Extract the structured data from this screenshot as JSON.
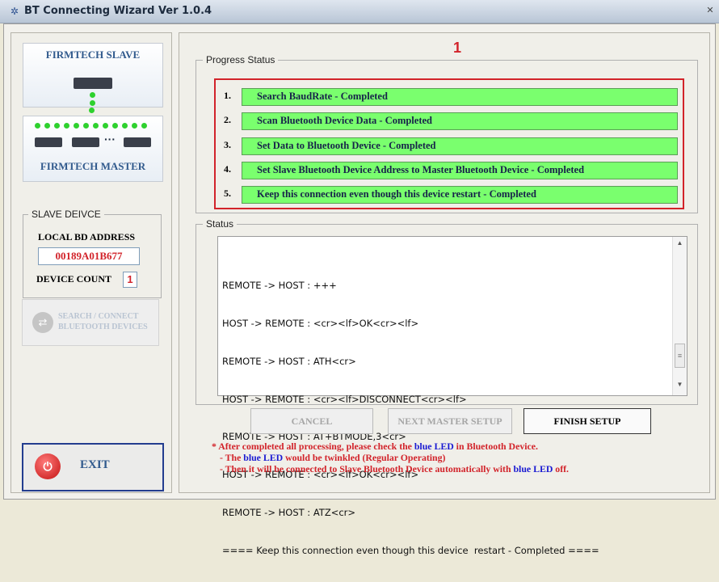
{
  "window": {
    "title": "BT Connecting Wizard Ver 1.0.4",
    "app_icon": "bluetooth-wizard-icon",
    "close_icon": "close-icon"
  },
  "left": {
    "slave_title": "FIRMTECH SLAVE",
    "master_title": "FIRMTECH MASTER",
    "slave_device": {
      "legend": "SLAVE DEIVCE",
      "local_bd_label": "LOCAL BD ADDRESS",
      "local_bd_value": "00189A01B677",
      "count_label": "DEVICE COUNT",
      "count_value": "1"
    },
    "search_button": {
      "line1": "SEARCH / CONNECT",
      "line2": "BLUETOOTH DEVICES",
      "icon": "search-connect-icon"
    },
    "exit_button": {
      "label": "EXIT",
      "icon": "power-icon"
    }
  },
  "progress": {
    "legend": "Progress Status",
    "marker": "1",
    "steps": [
      {
        "num": "1.",
        "text": "Search BaudRate - Completed"
      },
      {
        "num": "2.",
        "text": "Scan Bluetooth Device Data - Completed"
      },
      {
        "num": "3.",
        "text": "Set Data to Bluetooth Device - Completed"
      },
      {
        "num": "4.",
        "text": "Set Slave Bluetooth Device Address to Master Bluetooth Device - Completed"
      },
      {
        "num": "5.",
        "text": "Keep this connection even though this device  restart - Completed"
      }
    ]
  },
  "status": {
    "legend": "Status",
    "log": [
      "REMOTE -> HOST : +++",
      "HOST -> REMOTE : <cr><lf>OK<cr><lf>",
      "REMOTE -> HOST : ATH<cr>",
      "HOST -> REMOTE : <cr><lf>DISCONNECT<cr><lf>",
      "REMOTE -> HOST : AT+BTMODE,3<cr>",
      "HOST -> REMOTE : <cr><lf>OK<cr><lf>",
      "REMOTE -> HOST : ATZ<cr>",
      "==== Keep this connection even though this device  restart - Completed ===="
    ]
  },
  "buttons": {
    "cancel": "CANCEL",
    "next": "NEXT MASTER SETUP",
    "finish": "FINISH SETUP"
  },
  "notes": {
    "line1_a": "* After completed all processing, please check the ",
    "line1_b": "blue LED",
    "line1_c": " in Bluetooth Device.",
    "line2_a": "- The ",
    "line2_b": "blue LED",
    "line2_c": " would be twinkled (Regular Operating)",
    "line3_a": "- Then it will be connected to Slave Bluetooth Device automatically with ",
    "line3_b": "blue LED",
    "line3_c": " off."
  },
  "colors": {
    "accent_red": "#d2232a",
    "progress_green": "#7aff6e",
    "title_blue": "#315a8d",
    "note_blue": "#1a1ad2"
  }
}
